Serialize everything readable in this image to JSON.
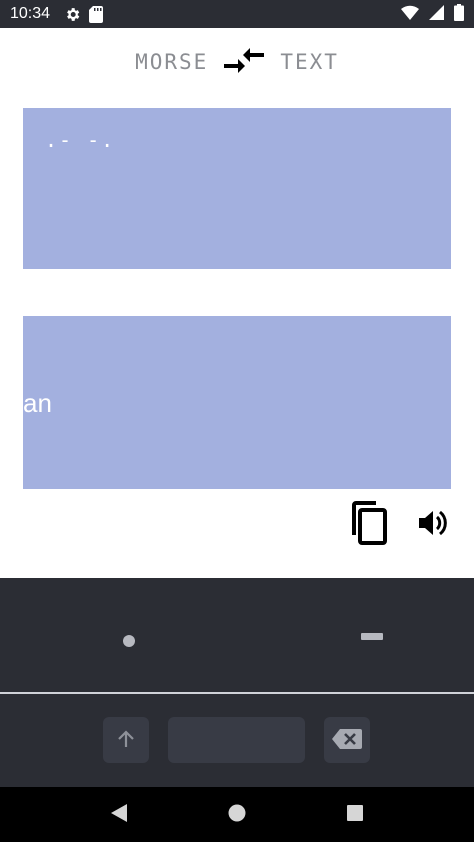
{
  "status_bar": {
    "time": "10:34",
    "icons": [
      "gear-icon",
      "sd-card-icon",
      "wifi-icon",
      "signal-icon",
      "battery-icon"
    ]
  },
  "header": {
    "left_label": "MORSE",
    "right_label": "TEXT",
    "swap_icon": "swap-arrows-icon"
  },
  "input_panel": {
    "value": ".- -."
  },
  "output_panel": {
    "value": "an"
  },
  "actions": {
    "copy_icon": "copy-icon",
    "speak_icon": "speaker-icon"
  },
  "keyboard": {
    "dot_icon": "dot-icon",
    "dash_icon": "dash-icon",
    "shift_icon": "arrow-up-icon",
    "backspace_icon": "backspace-icon"
  },
  "nav_bar": {
    "icons": [
      "back-icon",
      "home-icon",
      "recents-icon"
    ]
  },
  "colors": {
    "panel": "#a3b0df",
    "keyboard_bg": "#2b2d34",
    "label_gray": "#8b8d92"
  }
}
